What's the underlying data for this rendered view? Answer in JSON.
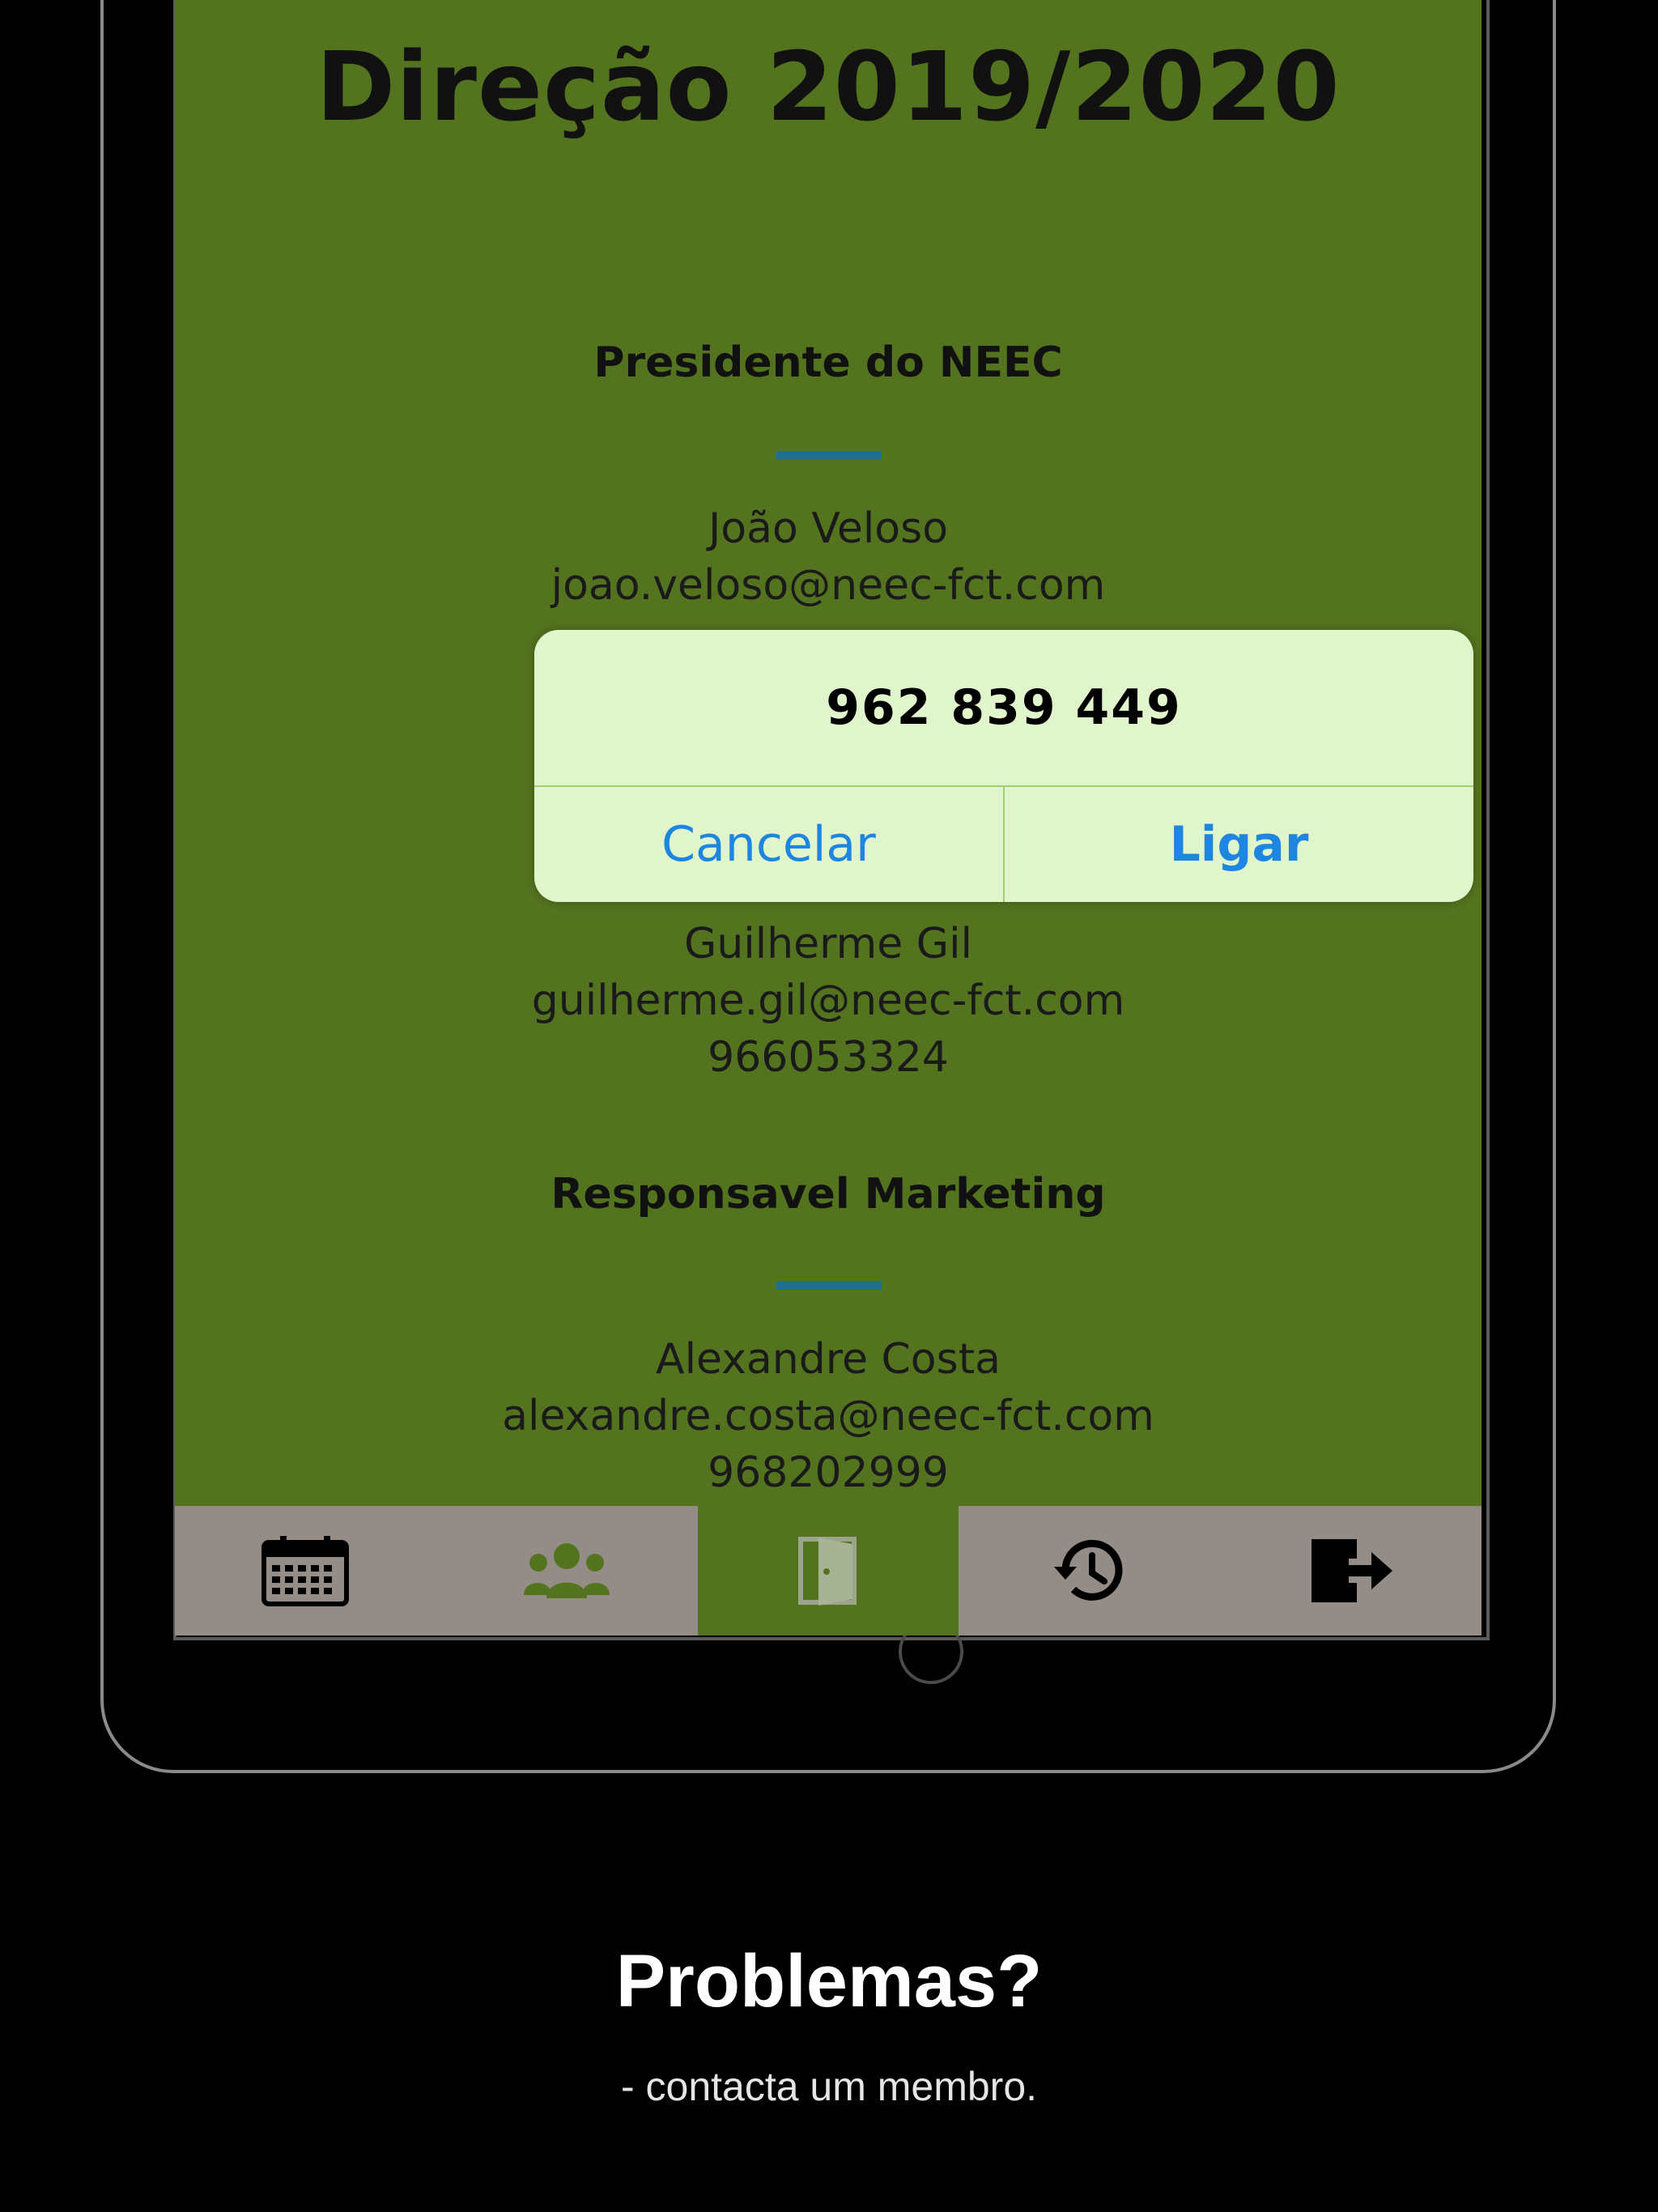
{
  "page": {
    "title": "Direção 2019/2020",
    "sections": [
      {
        "role": "Presidente do NEEC",
        "name": "João Veloso",
        "email": "joao.veloso@neec-fct.com"
      },
      {
        "name": "Guilherme Gil",
        "email": "guilherme.gil@neec-fct.com",
        "phone": "966053324"
      },
      {
        "role": "Responsavel Marketing",
        "name": "Alexandre Costa",
        "email": "alexandre.costa@neec-fct.com",
        "phone": "968202999"
      }
    ]
  },
  "dialog": {
    "number": "962 839 449",
    "cancel_label": "Cancelar",
    "call_label": "Ligar"
  },
  "tabbar": {
    "tabs": [
      {
        "icon": "calendar-icon",
        "active": false
      },
      {
        "icon": "group-icon",
        "active": false
      },
      {
        "icon": "door-icon",
        "active": true
      },
      {
        "icon": "history-icon",
        "active": false
      },
      {
        "icon": "logout-icon",
        "active": false
      }
    ]
  },
  "caption": {
    "title": "Problemas?",
    "subtitle": "- contacta um membro."
  },
  "colors": {
    "screen_bg": "#53731f",
    "tabbar_bg": "#938c87",
    "accent_line": "#1f6f8b",
    "dialog_bg": "#e1f5cc",
    "dialog_button": "#1c86e0"
  }
}
